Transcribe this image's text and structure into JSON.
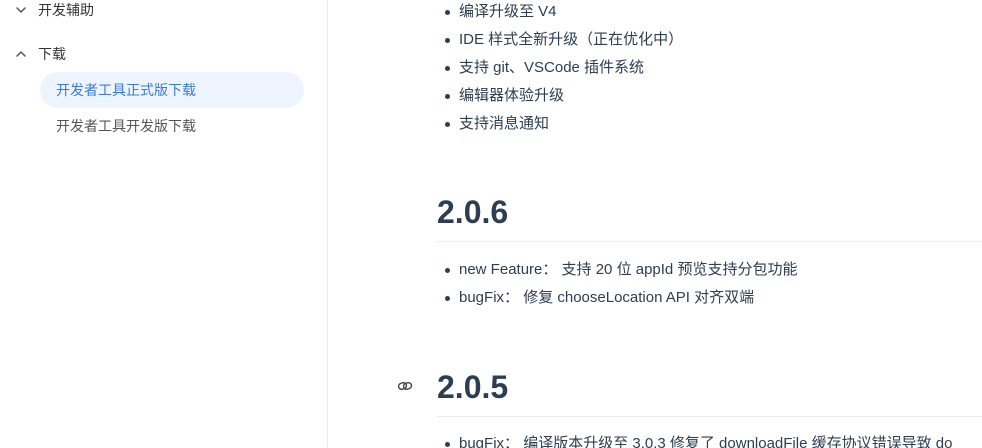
{
  "sidebar": {
    "group_dev_assist": "开发辅助",
    "group_download": "下载",
    "items": [
      {
        "label": "开发者工具正式版下载",
        "active": true
      },
      {
        "label": "开发者工具开发版下载",
        "active": false
      }
    ]
  },
  "content": {
    "top_list": [
      "编译升级至 V4",
      "IDE 样式全新升级（正在优化中）",
      "支持 git、VSCode 插件系统",
      "编辑器体验升级",
      "支持消息通知"
    ],
    "v206": {
      "title": "2.0.6",
      "items": [
        "new Feature： 支持 20 位 appId 预览支持分包功能",
        "bugFix： 修复 chooseLocation API 对齐双端"
      ]
    },
    "v205": {
      "title": "2.0.5",
      "items": [
        "bugFix： 编译版本升级至 3.0.3 修复了 downloadFile 缓存协议错误导致 do"
      ]
    }
  }
}
